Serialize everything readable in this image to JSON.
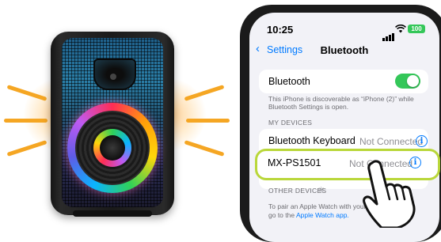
{
  "status_bar": {
    "time": "10:25",
    "battery": "100",
    "icons": [
      "cellular-signal-icon",
      "wifi-icon",
      "battery-icon"
    ]
  },
  "nav": {
    "back_label": "Settings",
    "title": "Bluetooth"
  },
  "bluetooth": {
    "label": "Bluetooth",
    "enabled": true,
    "discoverable_text": "This iPhone is discoverable as “iPhone (2)” while Bluetooth Settings is open."
  },
  "my_devices": {
    "header": "MY DEVICES",
    "items": [
      {
        "name": "Bluetooth Keyboard",
        "status": "Not Connected"
      },
      {
        "name": "MX-PS1501",
        "status": "Not Connected"
      }
    ]
  },
  "other_devices": {
    "header": "OTHER DEVICES",
    "pair_text": "To pair an Apple Watch with your iPhone, go to the",
    "pair_link": "Apple Watch app."
  },
  "colors": {
    "accent": "#007aff",
    "toggle_on": "#34c759",
    "highlight": "#b9d73a",
    "sound_rays": "#f5a623"
  }
}
